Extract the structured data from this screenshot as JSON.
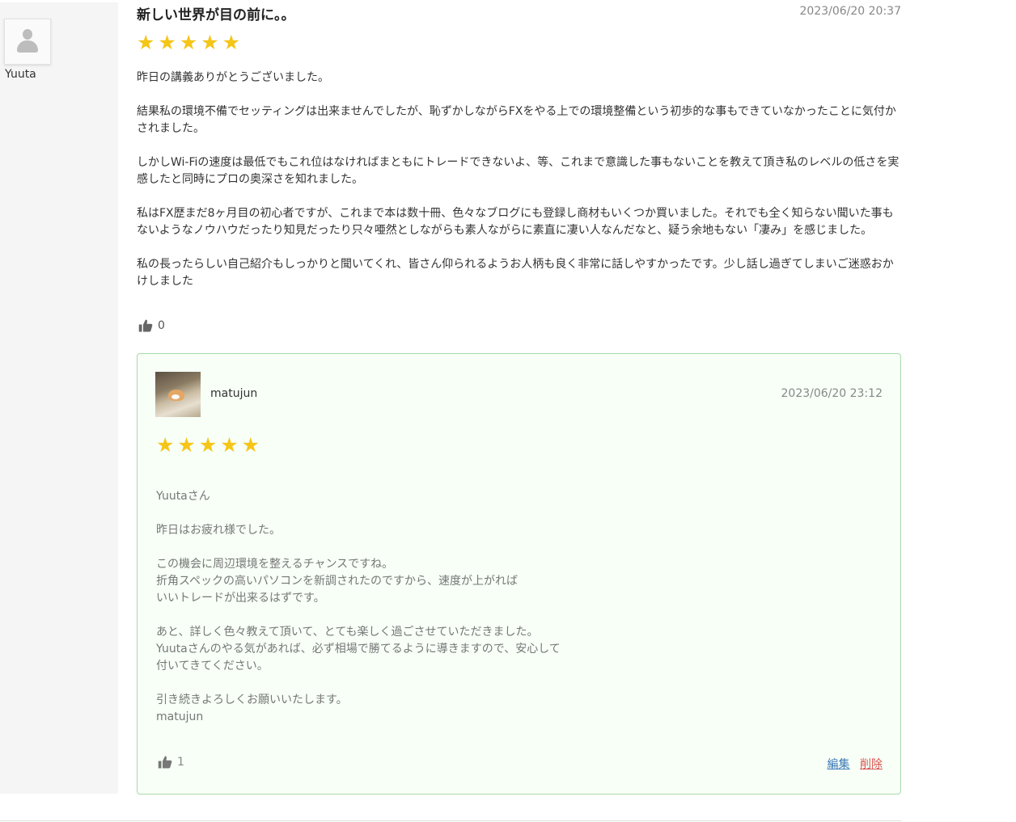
{
  "review": {
    "author": "Yuuta",
    "title": "新しい世界が目の前に。。",
    "date": "2023/06/20 20:37",
    "stars": "★★★★★",
    "rating": 5,
    "paragraphs": [
      "昨日の講義ありがとうございました。",
      "結果私の環境不備でセッティングは出来ませんでしたが、恥ずかしながらFXをやる上での環境整備という初歩的な事もできていなかったことに気付かされました。",
      "しかしWi-Fiの速度は最低でもこれ位はなければまともにトレードできないよ、等、これまで意識した事もないことを教えて頂き私のレベルの低さを実感したと同時にプロの奥深さを知れました。",
      "私はFX歴まだ8ヶ月目の初心者ですが、これまで本は数十冊、色々なブログにも登録し商材もいくつか買いました。それでも全く知らない聞いた事もないようなノウハウだったり知見だったり只々唖然としながらも素人ながらに素直に凄い人なんだなと、疑う余地もない「凄み」を感じました。",
      "私の長ったらしい自己紹介もしっかりと聞いてくれ、皆さん仰られるようお人柄も良く非常に話しやすかったです。少し話し過ぎてしまいご迷惑おかけしました"
    ],
    "likes": "0"
  },
  "reply": {
    "author": "matujun",
    "date": "2023/06/20 23:12",
    "stars": "★★★★★",
    "rating": 5,
    "paragraphs": [
      [
        "Yuutaさん"
      ],
      [
        "昨日はお疲れ様でした。"
      ],
      [
        "この機会に周辺環境を整えるチャンスですね。",
        "折角スペックの高いパソコンを新調されたのですから、速度が上がれば",
        "いいトレードが出来るはずです。"
      ],
      [
        "あと、詳しく色々教えて頂いて、とても楽しく過ごさせていただきました。",
        "Yuutaさんのやる気があれば、必ず相場で勝てるように導きますので、安心して",
        "付いてきてください。"
      ],
      [
        "引き続きよろしくお願いいたします。",
        "matujun"
      ]
    ],
    "likes": "1",
    "edit_label": "編集",
    "delete_label": "削除"
  },
  "colors": {
    "star": "#f5c518",
    "reply_border": "#a9d9a9",
    "reply_bg": "#f7fff7",
    "edit_link": "#3d7ab8",
    "delete_link": "#d9534f"
  },
  "icons": {
    "avatar_placeholder": "user-silhouette-icon",
    "like": "thumbs-up-icon"
  }
}
